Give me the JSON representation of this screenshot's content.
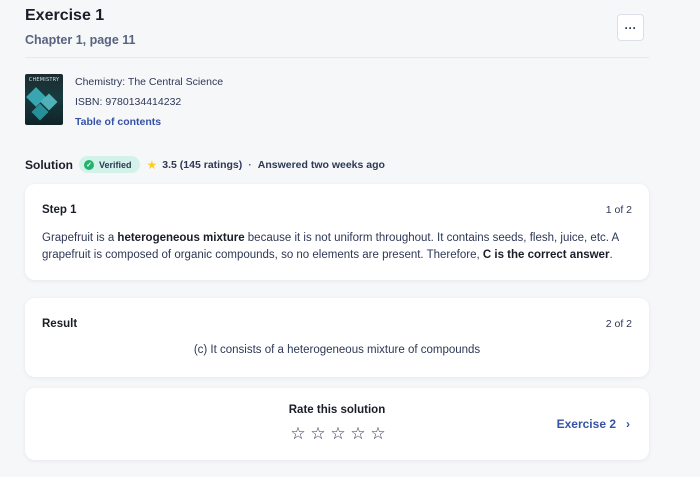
{
  "header": {
    "title": "Exercise 1",
    "subtitle": "Chapter 1, page 11",
    "more_label": "···"
  },
  "book": {
    "cover_text": "CHEMISTRY",
    "title": "Chemistry: The Central Science",
    "isbn": "ISBN: 9780134414232",
    "toc": "Table of contents"
  },
  "solution": {
    "label": "Solution",
    "verified": "Verified",
    "rating": "3.5 (145 ratings)",
    "separator": "·",
    "answered": "Answered two weeks ago"
  },
  "step": {
    "head": "Step 1",
    "count": "1 of 2",
    "t1": "Grapefruit is a ",
    "t2": "heterogeneous mixture",
    "t3": " because it is not uniform throughout. It contains seeds, flesh, juice, etc. A grapefruit is composed of organic compounds, so no elements are present. Therefore, ",
    "t4": "C is the correct answer",
    "t5": "."
  },
  "result": {
    "head": "Result",
    "count": "2 of 2",
    "text": "(c) It consists of a heterogeneous mixture of compounds"
  },
  "rate": {
    "title": "Rate this solution",
    "stars": [
      "☆",
      "☆",
      "☆",
      "☆",
      "☆"
    ],
    "next_label": "Exercise 2",
    "next_icon": "›"
  },
  "colors": {
    "accent": "#3552a8",
    "verified_bg": "#d3f3ea",
    "check": "#23b26d",
    "star": "#ffcd1f"
  }
}
